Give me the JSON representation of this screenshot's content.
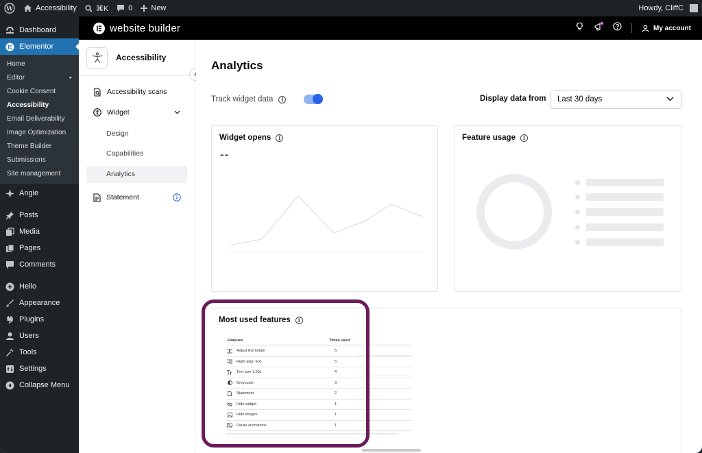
{
  "admin_bar": {
    "site_name": "Accessibility",
    "shortcut": "⌘K",
    "comments_count": "0",
    "new_label": "New",
    "greeting": "Howdy, CliffC"
  },
  "wp_menu": {
    "dashboard": "Dashboard",
    "elementor": "Elementor",
    "submenu": [
      "Home",
      "Editor",
      "Cookie Consent",
      "Accessibility",
      "Email Deliverability",
      "Image Optimization",
      "Theme Builder",
      "Submissions",
      "Site management"
    ],
    "angie": "Angie",
    "posts": "Posts",
    "media": "Media",
    "pages": "Pages",
    "comments": "Comments",
    "hello": "Hello",
    "appearance": "Appearance",
    "plugins": "Plugins",
    "users": "Users",
    "tools": "Tools",
    "settings": "Settings",
    "collapse": "Collapse Menu"
  },
  "header": {
    "brand": "website builder",
    "account": "My account"
  },
  "plugin_nav": {
    "title": "Accessibility",
    "scans": "Accessibility scans",
    "widget": "Widget",
    "design": "Design",
    "capabilities": "Capabilities",
    "analytics": "Analytics",
    "statement": "Statement"
  },
  "main": {
    "title": "Analytics",
    "track_label": "Track widget data",
    "display_label": "Display data from",
    "range_value": "Last 30 days",
    "widget_opens_title": "Widget opens",
    "widget_opens_value": "--",
    "feature_usage_title": "Feature usage",
    "most_used_title": "Most used features",
    "track_enabled": true
  },
  "features_table": {
    "col_feature": "Features",
    "col_times": "Times used",
    "rows": [
      {
        "icon": "line-height-icon",
        "name": "Adjust line height",
        "times": "5"
      },
      {
        "icon": "align-right-icon",
        "name": "Right align text",
        "times": "5"
      },
      {
        "icon": "text-size-icon",
        "name": "Text size 1.50x",
        "times": "4"
      },
      {
        "icon": "contrast-icon",
        "name": "Greyscale",
        "times": "3"
      },
      {
        "icon": "document-icon",
        "name": "Statement",
        "times": "2"
      },
      {
        "icon": "eye-off-icon",
        "name": "Hide widget",
        "times": "1"
      },
      {
        "icon": "image-icon",
        "name": "Hide images",
        "times": "1"
      },
      {
        "icon": "pause-animation-icon",
        "name": "Pause animations",
        "times": "1"
      }
    ]
  },
  "colors": {
    "wp_dark": "#1d2327",
    "wp_blue": "#2271b1",
    "toggle_blue": "#2563eb",
    "highlight": "#6a1b5a"
  }
}
